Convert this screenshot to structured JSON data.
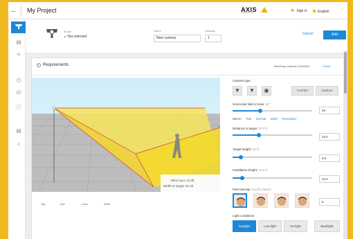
{
  "header": {
    "title": "My Project",
    "logo_text": "AXIS",
    "logo_sub": "COMMUNICATIONS",
    "sign_in": "Sign in",
    "language": "English"
  },
  "subbar": {
    "model_label": "Model",
    "model_value": "Not selected",
    "name_label": "Name",
    "name_value": "New camera",
    "quantity_label": "Quantity",
    "quantity_value": "1",
    "cancel": "Cancel",
    "add": "Add"
  },
  "requirements": {
    "title": "Requirements",
    "matching": "Matching cameras (105/229)",
    "reset": "Reset",
    "scene_blind_spot": "Blind spot: 13.0ft",
    "scene_width": "Width at target: 23.1ft",
    "views": [
      "Top",
      "Side",
      "Lens",
      "Orbit"
    ],
    "active_view": "Side"
  },
  "panel": {
    "camera_type": "Camera type",
    "corridor": "Corridor",
    "outdoor": "Outdoor",
    "hfov_label": "Horizontal field of view:",
    "hfov_sub": "55 °",
    "hfov_value": "55",
    "hfov_fraction": 0.35,
    "set_to": "Set to:",
    "set_options": [
      "Tele",
      "Normal",
      "Wide",
      "Panoramic"
    ],
    "distance_label": "Distance to target:",
    "distance_sub": "23.0 ft",
    "distance_value": "23.0",
    "distance_fraction": 0.33,
    "height_label": "Target height:",
    "height_sub": "8.0 ft",
    "height_value": "8.0",
    "height_fraction": 0.1,
    "install_label": "Installation height:",
    "install_sub": "10.0 ft",
    "install_value": "10.0",
    "install_fraction": 0.12,
    "density_label": "Pixel density:",
    "density_sub": "8 px/ft, Detect",
    "density_value": "8",
    "light_label": "Light conditions",
    "light_options": [
      "Daylight",
      "Low light",
      "No light",
      "Backlight"
    ],
    "light_selected": "Daylight"
  },
  "colors": {
    "accent": "#1e88d6",
    "brand": "#f0b200",
    "outer": "#f1b820"
  },
  "icons": {
    "back": "arrow-left-icon",
    "sign_in": "user-icon",
    "language": "globe-icon",
    "menu": "kebab-menu-icon"
  }
}
